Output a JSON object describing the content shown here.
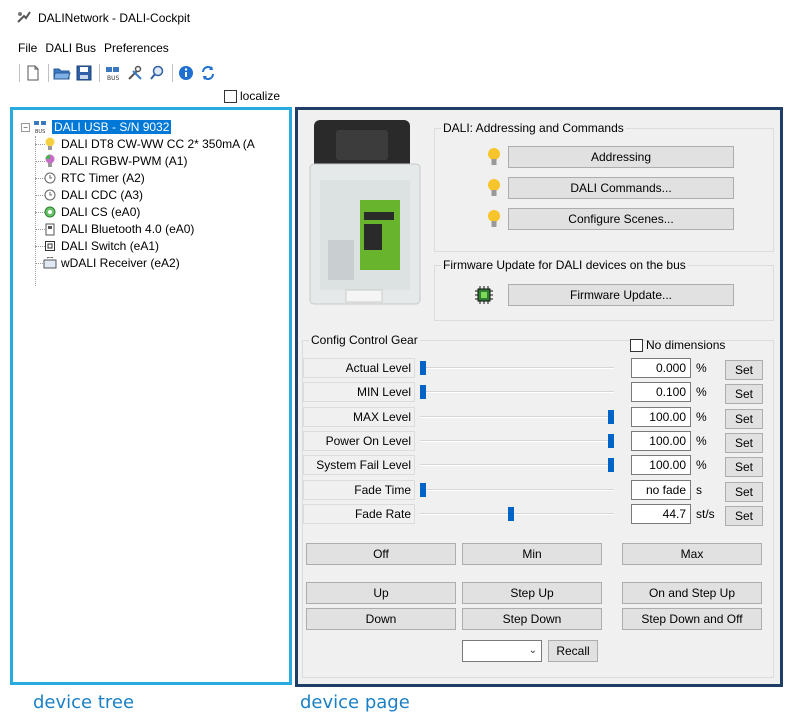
{
  "window": {
    "title": "DALINetwork - DALI-Cockpit"
  },
  "menu": {
    "items": [
      "File",
      "DALI Bus",
      "Preferences"
    ]
  },
  "toolbar": {
    "icons": [
      "new-file-icon",
      "open-folder-icon",
      "save-icon",
      "bus-icon",
      "tools-icon",
      "search-icon",
      "info-icon",
      "refresh-icon"
    ]
  },
  "localize": {
    "label": "localize",
    "checked": false
  },
  "tree": {
    "root": "DALI USB - S/N 9032",
    "items": [
      {
        "label": "DALI DT8 CW-WW CC 2* 350mA (A",
        "icon": "bulb-icon"
      },
      {
        "label": "DALI RGBW-PWM (A1)",
        "icon": "rgb-bulb-icon"
      },
      {
        "label": "RTC Timer (A2)",
        "icon": "clock-icon"
      },
      {
        "label": "DALI CDC (A3)",
        "icon": "clock-icon"
      },
      {
        "label": "DALI CS (eA0)",
        "icon": "sensor-icon"
      },
      {
        "label": "DALI Bluetooth 4.0 (eA0)",
        "icon": "bluetooth-module-icon"
      },
      {
        "label": "DALI Switch (eA1)",
        "icon": "switch-icon"
      },
      {
        "label": "wDALI Receiver (eA2)",
        "icon": "receiver-icon"
      }
    ]
  },
  "addressing": {
    "title": "DALI: Addressing and Commands",
    "buttons": [
      "Addressing",
      "DALI Commands...",
      "Configure Scenes..."
    ]
  },
  "firmware": {
    "title": "Firmware Update for DALI devices on the bus",
    "button": "Firmware Update..."
  },
  "config": {
    "title": "Config Control Gear",
    "no_dimensions": "No dimensions",
    "set_label": "Set",
    "rows": [
      {
        "label": "Actual Level",
        "value": "0.000",
        "unit": "%",
        "position": 0.0
      },
      {
        "label": "MIN Level",
        "value": "0.100",
        "unit": "%",
        "position": 0.0
      },
      {
        "label": "MAX Level",
        "value": "100.00",
        "unit": "%",
        "position": 1.0
      },
      {
        "label": "Power On Level",
        "value": "100.00",
        "unit": "%",
        "position": 1.0
      },
      {
        "label": "System Fail Level",
        "value": "100.00",
        "unit": "%",
        "position": 1.0
      },
      {
        "label": "Fade Time",
        "value": "no fade",
        "unit": "s",
        "position": 0.0
      },
      {
        "label": "Fade Rate",
        "value": "44.7",
        "unit": "st/s",
        "position": 0.47
      }
    ]
  },
  "commands": {
    "off": "Off",
    "min": "Min",
    "max": "Max",
    "up": "Up",
    "step_up": "Step Up",
    "on_and_step_up": "On and Step Up",
    "down": "Down",
    "step_down": "Step Down",
    "step_down_and_off": "Step Down and Off",
    "recall": "Recall",
    "scene_value": ""
  },
  "captions": {
    "tree": "device tree",
    "page": "device page",
    "color": "#1a7fc4"
  },
  "colors": {
    "tree_border": "#29abe2",
    "page_border": "#1f3e66",
    "selection": "#0078d7",
    "slider": "#0063c6"
  }
}
